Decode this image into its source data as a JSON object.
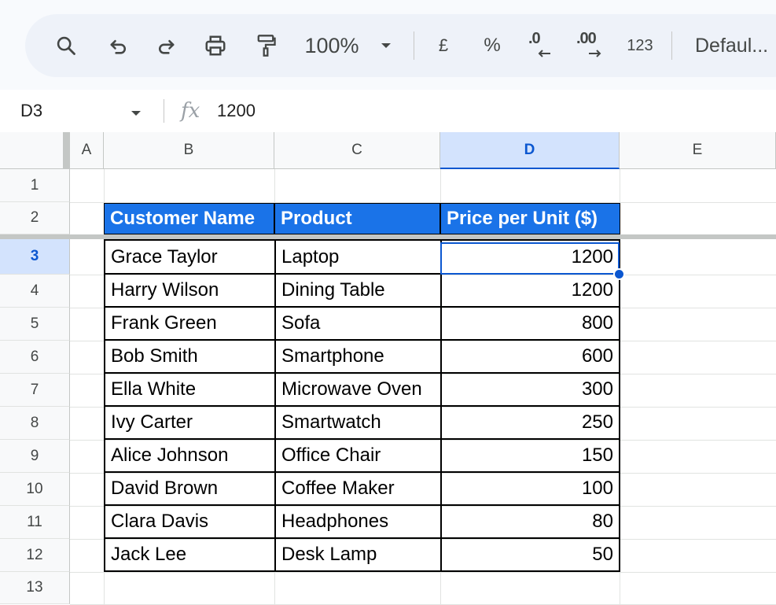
{
  "toolbar": {
    "icons": [
      "search-icon",
      "undo-icon",
      "redo-icon",
      "print-icon",
      "paint-format-icon"
    ],
    "zoom": "100%",
    "currency_symbol": "£",
    "percent_symbol": "%",
    "decrease_decimal": ".0",
    "increase_decimal": ".00",
    "number_format": "123",
    "font": "Defaul..."
  },
  "formula_bar": {
    "cell_ref": "D3",
    "fx": "fx",
    "value": "1200"
  },
  "columns": [
    "A",
    "B",
    "C",
    "D",
    "E"
  ],
  "selected_column": "D",
  "rows": [
    "1",
    "2",
    "3",
    "4",
    "5",
    "6",
    "7",
    "8",
    "9",
    "10",
    "11",
    "12",
    "13"
  ],
  "selected_row": "3",
  "table": {
    "headers": [
      "Customer Name",
      "Product",
      "Price per Unit ($)"
    ],
    "rows": [
      {
        "customer": "Grace Taylor",
        "product": "Laptop",
        "price": "1200"
      },
      {
        "customer": "Harry Wilson",
        "product": "Dining Table",
        "price": "1200"
      },
      {
        "customer": "Frank Green",
        "product": "Sofa",
        "price": "800"
      },
      {
        "customer": "Bob Smith",
        "product": "Smartphone",
        "price": "600"
      },
      {
        "customer": "Ella White",
        "product": "Microwave Oven",
        "price": "300"
      },
      {
        "customer": "Ivy Carter",
        "product": "Smartwatch",
        "price": "250"
      },
      {
        "customer": "Alice Johnson",
        "product": "Office Chair",
        "price": "150"
      },
      {
        "customer": "David Brown",
        "product": "Coffee Maker",
        "price": "100"
      },
      {
        "customer": "Clara Davis",
        "product": "Headphones",
        "price": "80"
      },
      {
        "customer": "Jack Lee",
        "product": "Desk Lamp",
        "price": "50"
      }
    ]
  },
  "colors": {
    "header_fill": "#1a73e8",
    "selection": "#0b57d0",
    "selected_header_bg": "#d3e3fd"
  }
}
